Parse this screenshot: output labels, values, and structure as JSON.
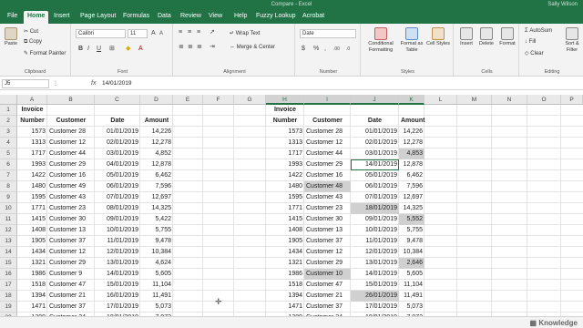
{
  "title_bar": {
    "title": "Compare - Excel",
    "user": "Sally Wilson"
  },
  "tabs": [
    "File",
    "Home",
    "Insert",
    "Page Layout",
    "Formulas",
    "Data",
    "Review",
    "View",
    "Help",
    "Fuzzy Lookup",
    "Acrobat"
  ],
  "active_tab": "Home",
  "ribbon": {
    "clipboard": {
      "paste": "Paste",
      "cut": "Cut",
      "copy": "Copy",
      "format_painter": "Format Painter",
      "label": "Clipboard"
    },
    "font": {
      "name": "Calibri",
      "size": "11",
      "label": "Font"
    },
    "alignment": {
      "wrap_text": "Wrap Text",
      "merge_center": "Merge & Center",
      "label": "Alignment"
    },
    "number": {
      "format": "Date",
      "label": "Number"
    },
    "styles": {
      "conditional": "Conditional Formatting",
      "format_as_table": "Format as Table",
      "cell_styles": "Cell Styles",
      "label": "Styles"
    },
    "cells": {
      "insert": "Insert",
      "delete": "Delete",
      "format": "Format",
      "label": "Cells"
    },
    "editing": {
      "autosum": "AutoSum",
      "fill": "Fill",
      "clear": "Clear",
      "sort_filter": "Sort & Filter",
      "label": "Editing"
    }
  },
  "formula_bar": {
    "name_box": "J5",
    "formula": "14/01/2019"
  },
  "columns": [
    "A",
    "B",
    "C",
    "D",
    "E",
    "F",
    "G",
    "H",
    "I",
    "J",
    "K",
    "L",
    "M",
    "N",
    "O",
    "P"
  ],
  "selected_columns": [
    "H",
    "I",
    "J",
    "K"
  ],
  "headers_left": {
    "invoice": "Invoice",
    "number": "Number",
    "customer": "Customer",
    "date": "Date",
    "amount": "Amount"
  },
  "headers_right": {
    "invoice": "Invoice",
    "number": "Number",
    "customer": "Customer",
    "date": "Date",
    "amount": "Amount"
  },
  "rows_left": [
    [
      "1573",
      "Customer 28",
      "01/01/2019",
      "14,226"
    ],
    [
      "1313",
      "Customer 12",
      "02/01/2019",
      "12,278"
    ],
    [
      "1717",
      "Customer 44",
      "03/01/2019",
      "4,852"
    ],
    [
      "1993",
      "Customer 29",
      "04/01/2019",
      "12,878"
    ],
    [
      "1422",
      "Customer 16",
      "05/01/2019",
      "6,462"
    ],
    [
      "1480",
      "Customer 49",
      "06/01/2019",
      "7,596"
    ],
    [
      "1595",
      "Customer 43",
      "07/01/2019",
      "12,697"
    ],
    [
      "1771",
      "Customer 23",
      "08/01/2019",
      "14,325"
    ],
    [
      "1415",
      "Customer 30",
      "09/01/2019",
      "5,422"
    ],
    [
      "1408",
      "Customer 13",
      "10/01/2019",
      "5,755"
    ],
    [
      "1905",
      "Customer 37",
      "11/01/2019",
      "9,478"
    ],
    [
      "1434",
      "Customer 12",
      "12/01/2019",
      "10,384"
    ],
    [
      "1321",
      "Customer 29",
      "13/01/2019",
      "4,624"
    ],
    [
      "1986",
      "Customer 9",
      "14/01/2019",
      "5,605"
    ],
    [
      "1518",
      "Customer 47",
      "15/01/2019",
      "11,104"
    ],
    [
      "1394",
      "Customer 21",
      "16/01/2019",
      "11,491"
    ],
    [
      "1471",
      "Customer 37",
      "17/01/2019",
      "5,073"
    ],
    [
      "1309",
      "Customer 24",
      "18/01/2019",
      "7,972"
    ]
  ],
  "rows_right": [
    [
      "1573",
      "Customer 28",
      "01/01/2019",
      "14,226"
    ],
    [
      "1313",
      "Customer 12",
      "02/01/2019",
      "12,278"
    ],
    [
      "1717",
      "Customer 44",
      "03/01/2019",
      "4,853"
    ],
    [
      "1993",
      "Customer 29",
      "14/01/2019",
      "12,878"
    ],
    [
      "1422",
      "Customer 16",
      "05/01/2019",
      "6,462"
    ],
    [
      "1480",
      "Customer 48",
      "06/01/2019",
      "7,596"
    ],
    [
      "1595",
      "Customer 43",
      "07/01/2019",
      "12,697"
    ],
    [
      "1771",
      "Customer 23",
      "18/01/2019",
      "14,325"
    ],
    [
      "1415",
      "Customer 30",
      "09/01/2019",
      "5,552"
    ],
    [
      "1408",
      "Customer 13",
      "10/01/2019",
      "5,755"
    ],
    [
      "1905",
      "Customer 37",
      "11/01/2019",
      "9,478"
    ],
    [
      "1434",
      "Customer 12",
      "12/01/2019",
      "10,384"
    ],
    [
      "1321",
      "Customer 29",
      "13/01/2019",
      "2,646"
    ],
    [
      "1986",
      "Customer 10",
      "14/01/2019",
      "5,605"
    ],
    [
      "1518",
      "Customer 47",
      "15/01/2019",
      "11,104"
    ],
    [
      "1394",
      "Customer 21",
      "26/01/2019",
      "11,491"
    ],
    [
      "1471",
      "Customer 37",
      "17/01/2019",
      "5,073"
    ],
    [
      "1309",
      "Customer 24",
      "18/01/2019",
      "7,972"
    ]
  ],
  "highlighted_cells_right": [
    {
      "row": 2,
      "col": 3
    },
    {
      "row": 5,
      "col": 1
    },
    {
      "row": 7,
      "col": 2
    },
    {
      "row": 8,
      "col": 3
    },
    {
      "row": 12,
      "col": 3
    },
    {
      "row": 13,
      "col": 1
    },
    {
      "row": 15,
      "col": 2
    }
  ],
  "active_cell_right": {
    "row": 3,
    "col": 2
  },
  "watermark": "Knowledge",
  "colors": {
    "excel_green": "#217346",
    "highlight": "#d0d0d0"
  }
}
